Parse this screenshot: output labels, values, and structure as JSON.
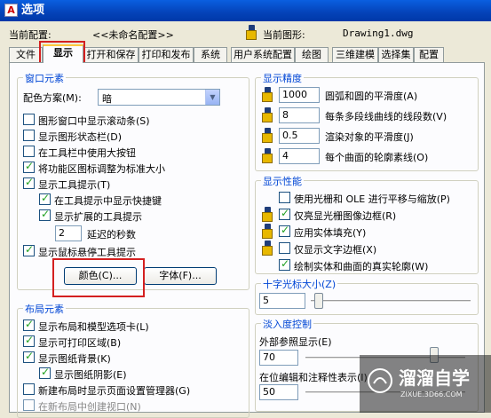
{
  "window": {
    "title": "选项"
  },
  "header": {
    "current_profile_label": "当前配置:",
    "current_profile_value": "<<未命名配置>>",
    "current_drawing_label": "当前图形:",
    "current_drawing_value": "Drawing1.dwg"
  },
  "tabs": [
    "文件",
    "显示",
    "打开和保存",
    "打印和发布",
    "系统",
    "用户系统配置",
    "绘图",
    "三维建模",
    "选择集",
    "配置"
  ],
  "window_elements": {
    "title": "窗口元素",
    "color_scheme_label": "配色方案(M):",
    "color_scheme_value": "暗",
    "checkboxes": [
      "图形窗口中显示滚动条(S)",
      "显示图形状态栏(D)",
      "在工具栏中使用大按钮",
      "将功能区图标调整为标准大小",
      "显示工具提示(T)",
      "在工具提示中显示快捷键",
      "显示扩展的工具提示",
      "显示鼠标悬停工具提示"
    ],
    "delay_value": "2",
    "delay_label": "延迟的秒数",
    "colors_button": "颜色(C)...",
    "fonts_button": "字体(F)..."
  },
  "layout_elements": {
    "title": "布局元素",
    "checkboxes": [
      "显示布局和模型选项卡(L)",
      "显示可打印区域(B)",
      "显示图纸背景(K)",
      "显示图纸阴影(E)",
      "新建布局时显示页面设置管理器(G)",
      "在新布局中创建视口(N)"
    ]
  },
  "display_resolution": {
    "title": "显示精度",
    "rows": [
      {
        "value": "1000",
        "label": "圆弧和圆的平滑度(A)"
      },
      {
        "value": "8",
        "label": "每条多段线曲线的线段数(V)"
      },
      {
        "value": "0.5",
        "label": "渲染对象的平滑度(J)"
      },
      {
        "value": "4",
        "label": "每个曲面的轮廓素线(O)"
      }
    ]
  },
  "display_performance": {
    "title": "显示性能",
    "checkboxes": [
      "使用光栅和 OLE 进行平移与缩放(P)",
      "仅亮显光栅图像边框(R)",
      "应用实体填充(Y)",
      "仅显示文字边框(X)",
      "绘制实体和曲面的真实轮廓(W)"
    ]
  },
  "crosshair": {
    "title": "十字光标大小(Z)",
    "value": "5"
  },
  "fade": {
    "title": "淡入度控制",
    "xref_label": "外部参照显示(E)",
    "xref_value": "70",
    "inplace_label": "在位编辑和注释性表示(I)",
    "inplace_value": "50"
  },
  "watermark": {
    "name": "溜溜自学",
    "url": "ZIXUE.3D66.COM"
  }
}
